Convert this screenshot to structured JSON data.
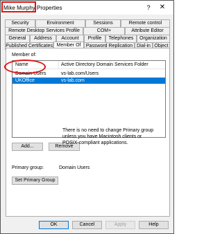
{
  "window": {
    "title_name": "Mike Murphy",
    "title_suffix": " Properties",
    "help_glyph": "?",
    "close_glyph": "✕"
  },
  "tabs": {
    "row1": [
      "Security",
      "Environment",
      "Sessions",
      "Remote control"
    ],
    "row2": [
      "Remote Desktop Services Profile",
      "COM+",
      "Attribute Editor"
    ],
    "row3": [
      "General",
      "Address",
      "Account",
      "Profile",
      "Telephones",
      "Organization"
    ],
    "row4": [
      "Published Certificates",
      "Member Of",
      "Password Replication",
      "Dial-in",
      "Object"
    ],
    "active": "Member Of"
  },
  "member_of": {
    "label": "Member of:",
    "columns": [
      "Name",
      "Active Directory Domain Services Folder"
    ],
    "rows": [
      {
        "name": "Domain Users",
        "folder": "vs-lab.com/Users",
        "selected": false
      },
      {
        "name": "UKOffice",
        "folder": "vs-lab.com",
        "selected": true
      }
    ]
  },
  "buttons": {
    "add": "Add...",
    "remove": "Remove",
    "set_primary": "Set Primary Group",
    "ok": "OK",
    "cancel": "Cancel",
    "apply": "Apply",
    "help": "Help"
  },
  "primary_group": {
    "label": "Primary group:",
    "value": "Domain Users",
    "note": "There is no need to change Primary group unless you have Macintosh clients or POSIX-compliant applications."
  },
  "colors": {
    "selection": "#0078d7",
    "annotation": "#e01010"
  }
}
